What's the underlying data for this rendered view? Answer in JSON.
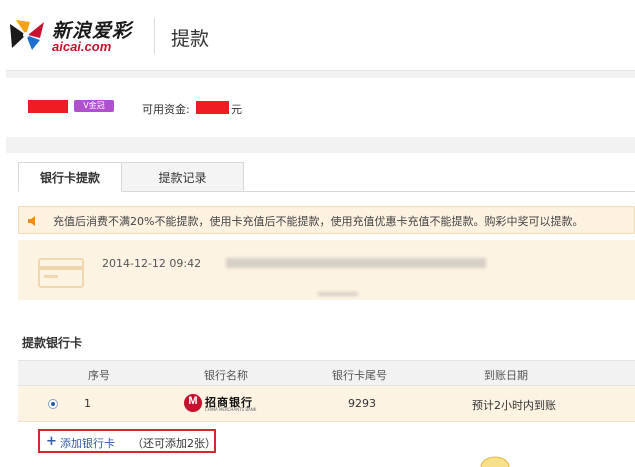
{
  "header": {
    "logo_cn": "新浪爱彩",
    "logo_en": "aicai.com",
    "page_title": "提款"
  },
  "account": {
    "vip_label": "V金冠",
    "balance_label": "可用资金:",
    "balance_unit": "元"
  },
  "tabs": [
    {
      "label": "银行卡提款",
      "active": true
    },
    {
      "label": "提款记录",
      "active": false
    }
  ],
  "notice": {
    "text": "充值后消费不满20%不能提款，使用卡充值后不能提款，使用充值优惠卡充值不能提款。购彩中奖可以提款。"
  },
  "record": {
    "time": "2014-12-12 09:42"
  },
  "bank_section": {
    "title": "提款银行卡",
    "columns": [
      "序号",
      "银行名称",
      "银行卡尾号",
      "到账日期"
    ],
    "rows": [
      {
        "index": "1",
        "bank_name": "招商银行",
        "bank_en": "CHINA MERCHANTS BANK",
        "card_tail": "9293",
        "arrival": "预计2小时内到账"
      }
    ]
  },
  "add_card": {
    "label": "添加银行卡",
    "hint": "（还可添加2张）"
  },
  "colors": {
    "accent_blue": "#2f5aa8",
    "redaction": "#ee1c25",
    "notice_bg": "#fdf1e0",
    "highlight_border": "#d9262c"
  }
}
